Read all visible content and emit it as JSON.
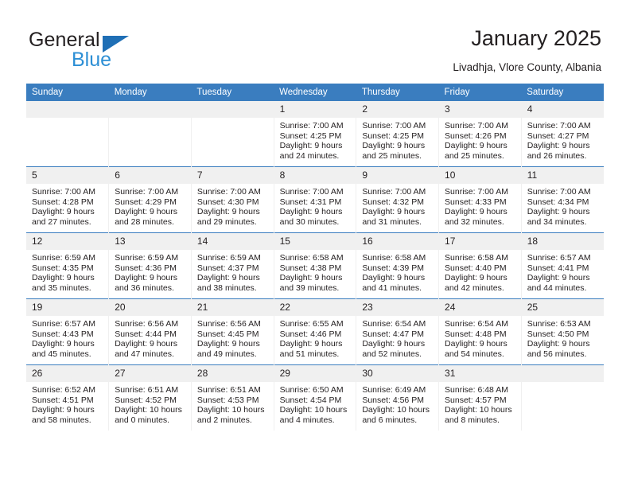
{
  "logo": {
    "word1": "General",
    "word2": "Blue",
    "triangle_color": "#1f6fb5",
    "blue_color": "#2d8fd5"
  },
  "header": {
    "title": "January 2025",
    "subtitle": "Livadhja, Vlore County, Albania"
  },
  "theme": {
    "header_blue": "#3a7dbf",
    "daynum_band": "#f0f0f0",
    "text": "#231f20"
  },
  "calendar": {
    "weekday_headers": [
      "Sunday",
      "Monday",
      "Tuesday",
      "Wednesday",
      "Thursday",
      "Friday",
      "Saturday"
    ],
    "weeks": [
      [
        {
          "day": "",
          "sunrise": "",
          "sunset": "",
          "daylight1": "",
          "daylight2": ""
        },
        {
          "day": "",
          "sunrise": "",
          "sunset": "",
          "daylight1": "",
          "daylight2": ""
        },
        {
          "day": "",
          "sunrise": "",
          "sunset": "",
          "daylight1": "",
          "daylight2": ""
        },
        {
          "day": "1",
          "sunrise": "Sunrise: 7:00 AM",
          "sunset": "Sunset: 4:25 PM",
          "daylight1": "Daylight: 9 hours",
          "daylight2": "and 24 minutes."
        },
        {
          "day": "2",
          "sunrise": "Sunrise: 7:00 AM",
          "sunset": "Sunset: 4:25 PM",
          "daylight1": "Daylight: 9 hours",
          "daylight2": "and 25 minutes."
        },
        {
          "day": "3",
          "sunrise": "Sunrise: 7:00 AM",
          "sunset": "Sunset: 4:26 PM",
          "daylight1": "Daylight: 9 hours",
          "daylight2": "and 25 minutes."
        },
        {
          "day": "4",
          "sunrise": "Sunrise: 7:00 AM",
          "sunset": "Sunset: 4:27 PM",
          "daylight1": "Daylight: 9 hours",
          "daylight2": "and 26 minutes."
        }
      ],
      [
        {
          "day": "5",
          "sunrise": "Sunrise: 7:00 AM",
          "sunset": "Sunset: 4:28 PM",
          "daylight1": "Daylight: 9 hours",
          "daylight2": "and 27 minutes."
        },
        {
          "day": "6",
          "sunrise": "Sunrise: 7:00 AM",
          "sunset": "Sunset: 4:29 PM",
          "daylight1": "Daylight: 9 hours",
          "daylight2": "and 28 minutes."
        },
        {
          "day": "7",
          "sunrise": "Sunrise: 7:00 AM",
          "sunset": "Sunset: 4:30 PM",
          "daylight1": "Daylight: 9 hours",
          "daylight2": "and 29 minutes."
        },
        {
          "day": "8",
          "sunrise": "Sunrise: 7:00 AM",
          "sunset": "Sunset: 4:31 PM",
          "daylight1": "Daylight: 9 hours",
          "daylight2": "and 30 minutes."
        },
        {
          "day": "9",
          "sunrise": "Sunrise: 7:00 AM",
          "sunset": "Sunset: 4:32 PM",
          "daylight1": "Daylight: 9 hours",
          "daylight2": "and 31 minutes."
        },
        {
          "day": "10",
          "sunrise": "Sunrise: 7:00 AM",
          "sunset": "Sunset: 4:33 PM",
          "daylight1": "Daylight: 9 hours",
          "daylight2": "and 32 minutes."
        },
        {
          "day": "11",
          "sunrise": "Sunrise: 7:00 AM",
          "sunset": "Sunset: 4:34 PM",
          "daylight1": "Daylight: 9 hours",
          "daylight2": "and 34 minutes."
        }
      ],
      [
        {
          "day": "12",
          "sunrise": "Sunrise: 6:59 AM",
          "sunset": "Sunset: 4:35 PM",
          "daylight1": "Daylight: 9 hours",
          "daylight2": "and 35 minutes."
        },
        {
          "day": "13",
          "sunrise": "Sunrise: 6:59 AM",
          "sunset": "Sunset: 4:36 PM",
          "daylight1": "Daylight: 9 hours",
          "daylight2": "and 36 minutes."
        },
        {
          "day": "14",
          "sunrise": "Sunrise: 6:59 AM",
          "sunset": "Sunset: 4:37 PM",
          "daylight1": "Daylight: 9 hours",
          "daylight2": "and 38 minutes."
        },
        {
          "day": "15",
          "sunrise": "Sunrise: 6:58 AM",
          "sunset": "Sunset: 4:38 PM",
          "daylight1": "Daylight: 9 hours",
          "daylight2": "and 39 minutes."
        },
        {
          "day": "16",
          "sunrise": "Sunrise: 6:58 AM",
          "sunset": "Sunset: 4:39 PM",
          "daylight1": "Daylight: 9 hours",
          "daylight2": "and 41 minutes."
        },
        {
          "day": "17",
          "sunrise": "Sunrise: 6:58 AM",
          "sunset": "Sunset: 4:40 PM",
          "daylight1": "Daylight: 9 hours",
          "daylight2": "and 42 minutes."
        },
        {
          "day": "18",
          "sunrise": "Sunrise: 6:57 AM",
          "sunset": "Sunset: 4:41 PM",
          "daylight1": "Daylight: 9 hours",
          "daylight2": "and 44 minutes."
        }
      ],
      [
        {
          "day": "19",
          "sunrise": "Sunrise: 6:57 AM",
          "sunset": "Sunset: 4:43 PM",
          "daylight1": "Daylight: 9 hours",
          "daylight2": "and 45 minutes."
        },
        {
          "day": "20",
          "sunrise": "Sunrise: 6:56 AM",
          "sunset": "Sunset: 4:44 PM",
          "daylight1": "Daylight: 9 hours",
          "daylight2": "and 47 minutes."
        },
        {
          "day": "21",
          "sunrise": "Sunrise: 6:56 AM",
          "sunset": "Sunset: 4:45 PM",
          "daylight1": "Daylight: 9 hours",
          "daylight2": "and 49 minutes."
        },
        {
          "day": "22",
          "sunrise": "Sunrise: 6:55 AM",
          "sunset": "Sunset: 4:46 PM",
          "daylight1": "Daylight: 9 hours",
          "daylight2": "and 51 minutes."
        },
        {
          "day": "23",
          "sunrise": "Sunrise: 6:54 AM",
          "sunset": "Sunset: 4:47 PM",
          "daylight1": "Daylight: 9 hours",
          "daylight2": "and 52 minutes."
        },
        {
          "day": "24",
          "sunrise": "Sunrise: 6:54 AM",
          "sunset": "Sunset: 4:48 PM",
          "daylight1": "Daylight: 9 hours",
          "daylight2": "and 54 minutes."
        },
        {
          "day": "25",
          "sunrise": "Sunrise: 6:53 AM",
          "sunset": "Sunset: 4:50 PM",
          "daylight1": "Daylight: 9 hours",
          "daylight2": "and 56 minutes."
        }
      ],
      [
        {
          "day": "26",
          "sunrise": "Sunrise: 6:52 AM",
          "sunset": "Sunset: 4:51 PM",
          "daylight1": "Daylight: 9 hours",
          "daylight2": "and 58 minutes."
        },
        {
          "day": "27",
          "sunrise": "Sunrise: 6:51 AM",
          "sunset": "Sunset: 4:52 PM",
          "daylight1": "Daylight: 10 hours",
          "daylight2": "and 0 minutes."
        },
        {
          "day": "28",
          "sunrise": "Sunrise: 6:51 AM",
          "sunset": "Sunset: 4:53 PM",
          "daylight1": "Daylight: 10 hours",
          "daylight2": "and 2 minutes."
        },
        {
          "day": "29",
          "sunrise": "Sunrise: 6:50 AM",
          "sunset": "Sunset: 4:54 PM",
          "daylight1": "Daylight: 10 hours",
          "daylight2": "and 4 minutes."
        },
        {
          "day": "30",
          "sunrise": "Sunrise: 6:49 AM",
          "sunset": "Sunset: 4:56 PM",
          "daylight1": "Daylight: 10 hours",
          "daylight2": "and 6 minutes."
        },
        {
          "day": "31",
          "sunrise": "Sunrise: 6:48 AM",
          "sunset": "Sunset: 4:57 PM",
          "daylight1": "Daylight: 10 hours",
          "daylight2": "and 8 minutes."
        },
        {
          "day": "",
          "sunrise": "",
          "sunset": "",
          "daylight1": "",
          "daylight2": ""
        }
      ]
    ]
  }
}
